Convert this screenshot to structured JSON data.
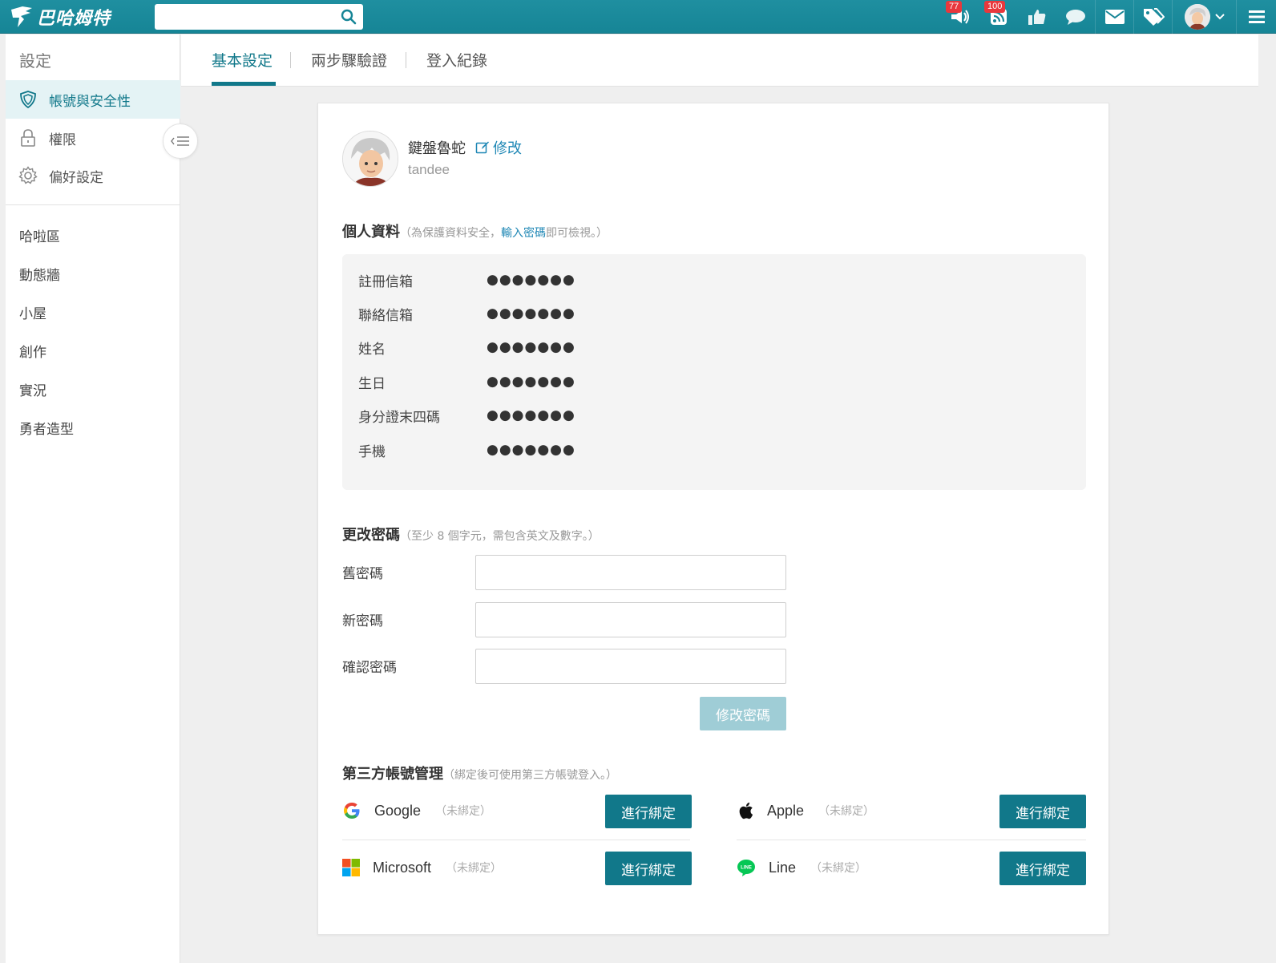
{
  "header": {
    "logo_text": "巴哈姆特",
    "search_placeholder": "",
    "badges": {
      "notifications": "77",
      "subscriptions": "100"
    },
    "icons": [
      "notification-icon",
      "rss-icon",
      "thumbs-up-icon",
      "chat-icon",
      "mail-icon",
      "tag-icon",
      "avatar",
      "chevron-down-icon",
      "menu-icon"
    ]
  },
  "sidebar": {
    "title": "設定",
    "items": [
      {
        "label": "帳號與安全性",
        "icon": "shield-icon",
        "active": true
      },
      {
        "label": "權限",
        "icon": "lock-icon"
      },
      {
        "label": "偏好設定",
        "icon": "gear-icon"
      }
    ],
    "links": [
      "哈啦區",
      "動態牆",
      "小屋",
      "創作",
      "實況",
      "勇者造型"
    ]
  },
  "tabs": [
    "基本設定",
    "兩步驟驗證",
    "登入紀錄"
  ],
  "profile": {
    "nickname": "鍵盤魯蛇",
    "edit_label": "修改",
    "username": "tandee"
  },
  "personal_info": {
    "title": "個人資料",
    "hint_prefix": "（為保護資料安全，",
    "hint_link": "輸入密碼",
    "hint_suffix": "即可檢視。）",
    "rows": [
      {
        "label": "註冊信箱",
        "value": "●●●●●●●"
      },
      {
        "label": "聯絡信箱",
        "value": "●●●●●●●"
      },
      {
        "label": "姓名",
        "value": "●●●●●●●"
      },
      {
        "label": "生日",
        "value": "●●●●●●●"
      },
      {
        "label": "身分證末四碼",
        "value": "●●●●●●●"
      },
      {
        "label": "手機",
        "value": "●●●●●●●"
      }
    ]
  },
  "change_password": {
    "title": "更改密碼",
    "hint": "（至少 8 個字元，需包含英文及數字。）",
    "old_label": "舊密碼",
    "new_label": "新密碼",
    "confirm_label": "確認密碼",
    "submit_label": "修改密碼"
  },
  "third_party": {
    "title": "第三方帳號管理",
    "hint": "（綁定後可使用第三方帳號登入。）",
    "bind_label": "進行綁定",
    "accounts": [
      {
        "name": "Google",
        "status": "（未綁定）"
      },
      {
        "name": "Apple",
        "status": "（未綁定）"
      },
      {
        "name": "Microsoft",
        "status": "（未綁定）"
      },
      {
        "name": "Line",
        "status": "（未綁定）"
      }
    ]
  },
  "colors": {
    "brand": "#168596",
    "accent": "#11788a",
    "link": "#1e87b5",
    "badge": "#e8383d"
  }
}
